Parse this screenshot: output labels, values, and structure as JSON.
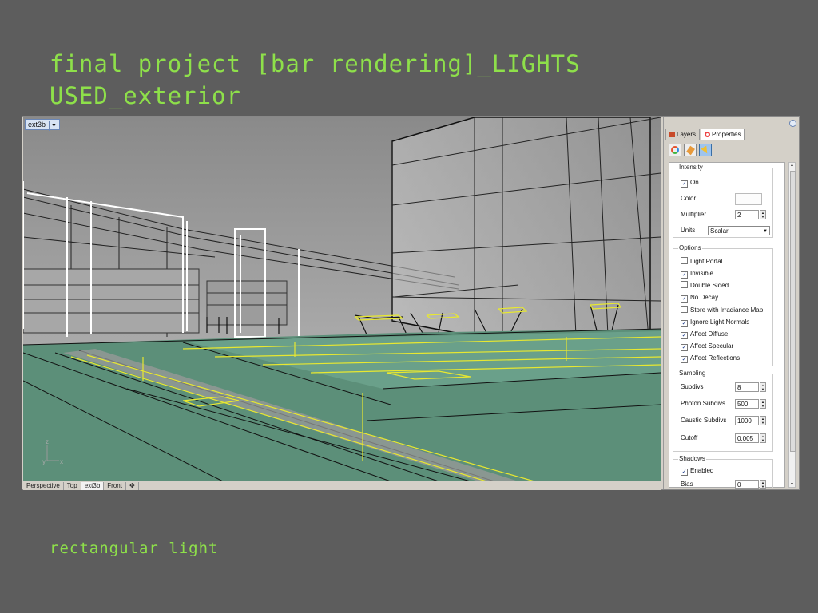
{
  "slide": {
    "title_line1": "final project [bar rendering]_LIGHTS",
    "title_line2": "USED_exterior",
    "caption": "rectangular light"
  },
  "viewport": {
    "title": "ext3b",
    "tabs": [
      "Perspective",
      "Top",
      "ext3b",
      "Front"
    ],
    "active_tab": "ext3b",
    "axis_labels": {
      "y": "y",
      "z": "z",
      "x": "x"
    }
  },
  "panel": {
    "tabs": {
      "layers": "Layers",
      "properties": "Properties"
    },
    "icons": [
      "material-icon",
      "render-brush-icon",
      "light-icon"
    ],
    "groups": {
      "intensity": {
        "title": "Intensity",
        "on_label": "On",
        "on_checked": true,
        "color_label": "Color",
        "color_value": "#fcfcfc",
        "multiplier_label": "Multiplier",
        "multiplier_value": "2",
        "units_label": "Units",
        "units_value": "Scalar"
      },
      "options": {
        "title": "Options",
        "items": [
          {
            "label": "Light Portal",
            "checked": false
          },
          {
            "label": "Invisible",
            "checked": true
          },
          {
            "label": "Double Sided",
            "checked": false
          },
          {
            "label": "No Decay",
            "checked": true
          },
          {
            "label": "Store with Irradiance Map",
            "checked": false
          },
          {
            "label": "Ignore Light Normals",
            "checked": true
          },
          {
            "label": "Affect Diffuse",
            "checked": true
          },
          {
            "label": "Affect Specular",
            "checked": true
          },
          {
            "label": "Affect Reflections",
            "checked": true
          }
        ]
      },
      "sampling": {
        "title": "Sampling",
        "subdivs_label": "Subdivs",
        "subdivs_value": "8",
        "photon_label": "Photon Subdivs",
        "photon_value": "500",
        "caustic_label": "Caustic Subdivs",
        "caustic_value": "1000",
        "cutoff_label": "Cutoff",
        "cutoff_value": "0.005"
      },
      "shadows": {
        "title": "Shadows",
        "enabled_label": "Enabled",
        "enabled_checked": true,
        "bias_label": "Bias",
        "bias_value": "0"
      }
    }
  },
  "colors": {
    "slide_bg": "#5d5d5d",
    "title_green": "#8ee04a",
    "floor_green": "#5c8f79",
    "light_yellow": "#e8e830"
  }
}
